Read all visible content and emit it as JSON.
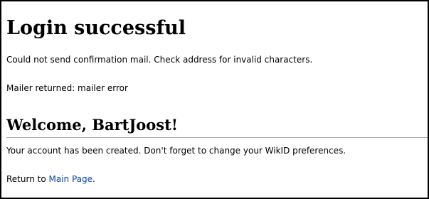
{
  "page": {
    "heading": "Login successful",
    "message_1": "Could not send confirmation mail. Check address for invalid characters.",
    "message_2": "Mailer returned: mailer error",
    "subheading": "Welcome, BartJoost!",
    "message_3": "Your account has been created. Don't forget to change your WikID preferences.",
    "return_prefix": "Return to ",
    "return_link": "Main Page",
    "return_suffix": "."
  },
  "colors": {
    "link": "#0645ad",
    "divider": "#aaaaaa",
    "text": "#000000",
    "background": "#ffffff"
  }
}
